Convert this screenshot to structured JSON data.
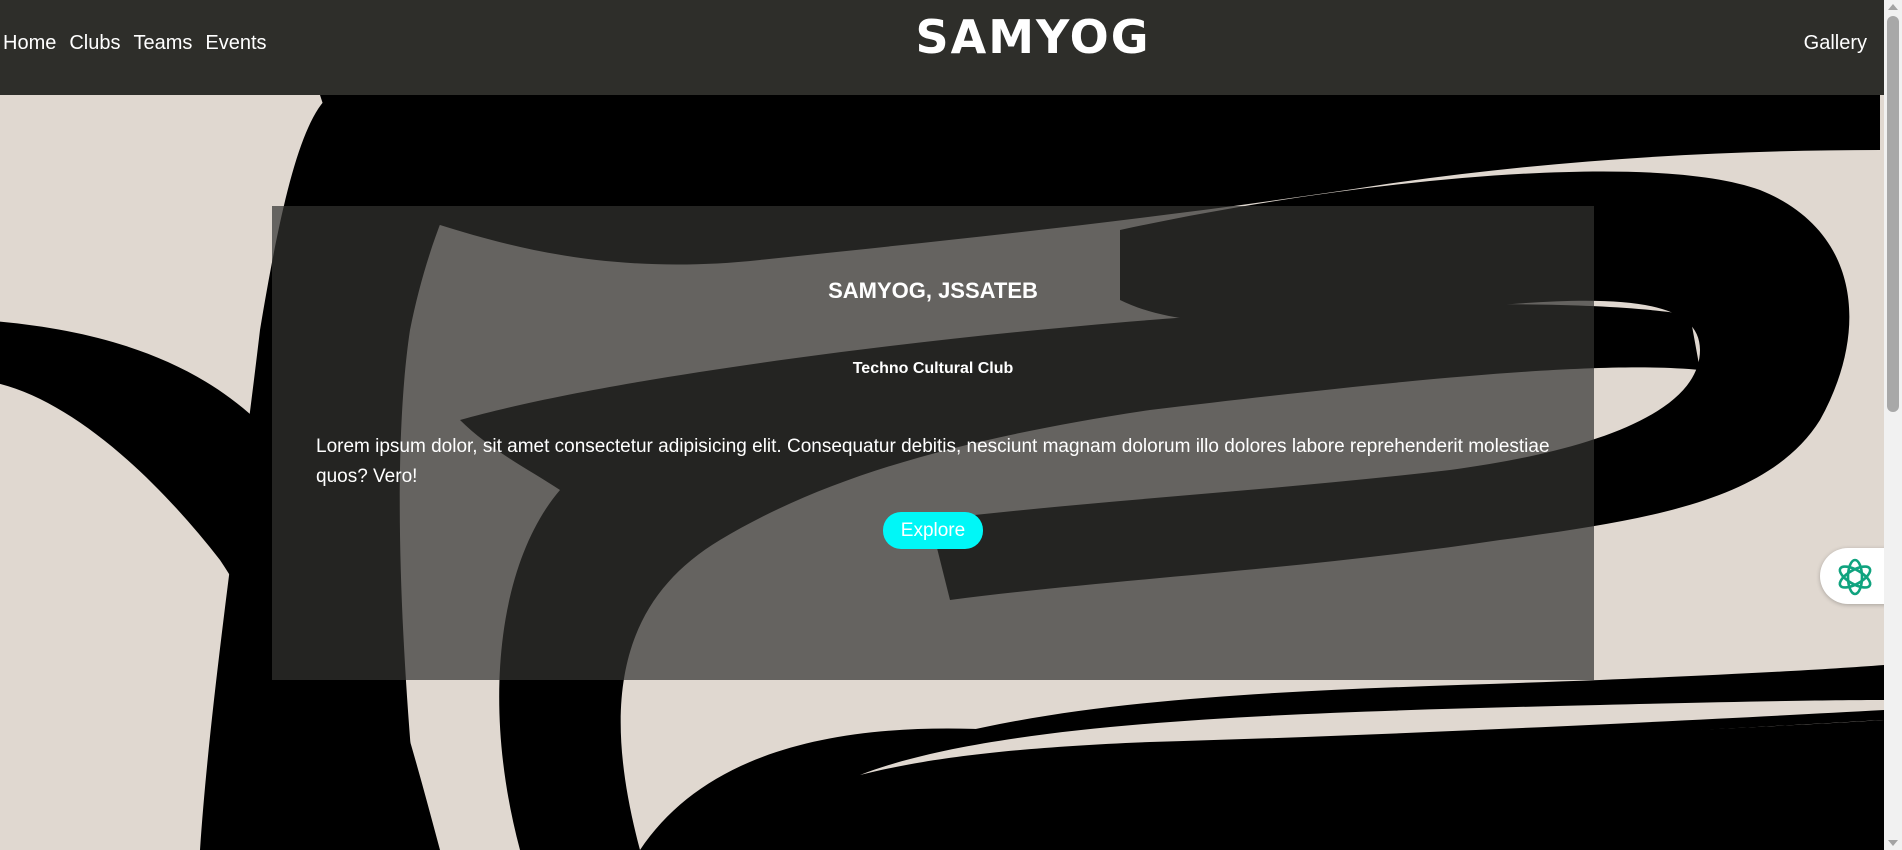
{
  "nav": {
    "left_links": [
      "Home",
      "Clubs",
      "Teams",
      "Events"
    ],
    "right_link": "Gallery",
    "logo_text": "SAMYOG"
  },
  "hero": {
    "title": "SAMYOG, JSSATEB",
    "subtitle": "Techno Cultural Club",
    "body": "Lorem ipsum dolor, sit amet consectetur adipisicing elit. Consequatur debitis, nesciunt magnam dolorum illo dolores labore reprehenderit molestiae quos? Vero!",
    "cta_label": "Explore"
  },
  "floating_widget": {
    "icon": "openai-knot-icon"
  },
  "colors": {
    "navbar_bg": "#2e2e2a",
    "page_bg": "#e0d8d0",
    "brush_stroke": "#000000",
    "cta_bg": "#00f7f7",
    "widget_icon": "#10a37f"
  }
}
